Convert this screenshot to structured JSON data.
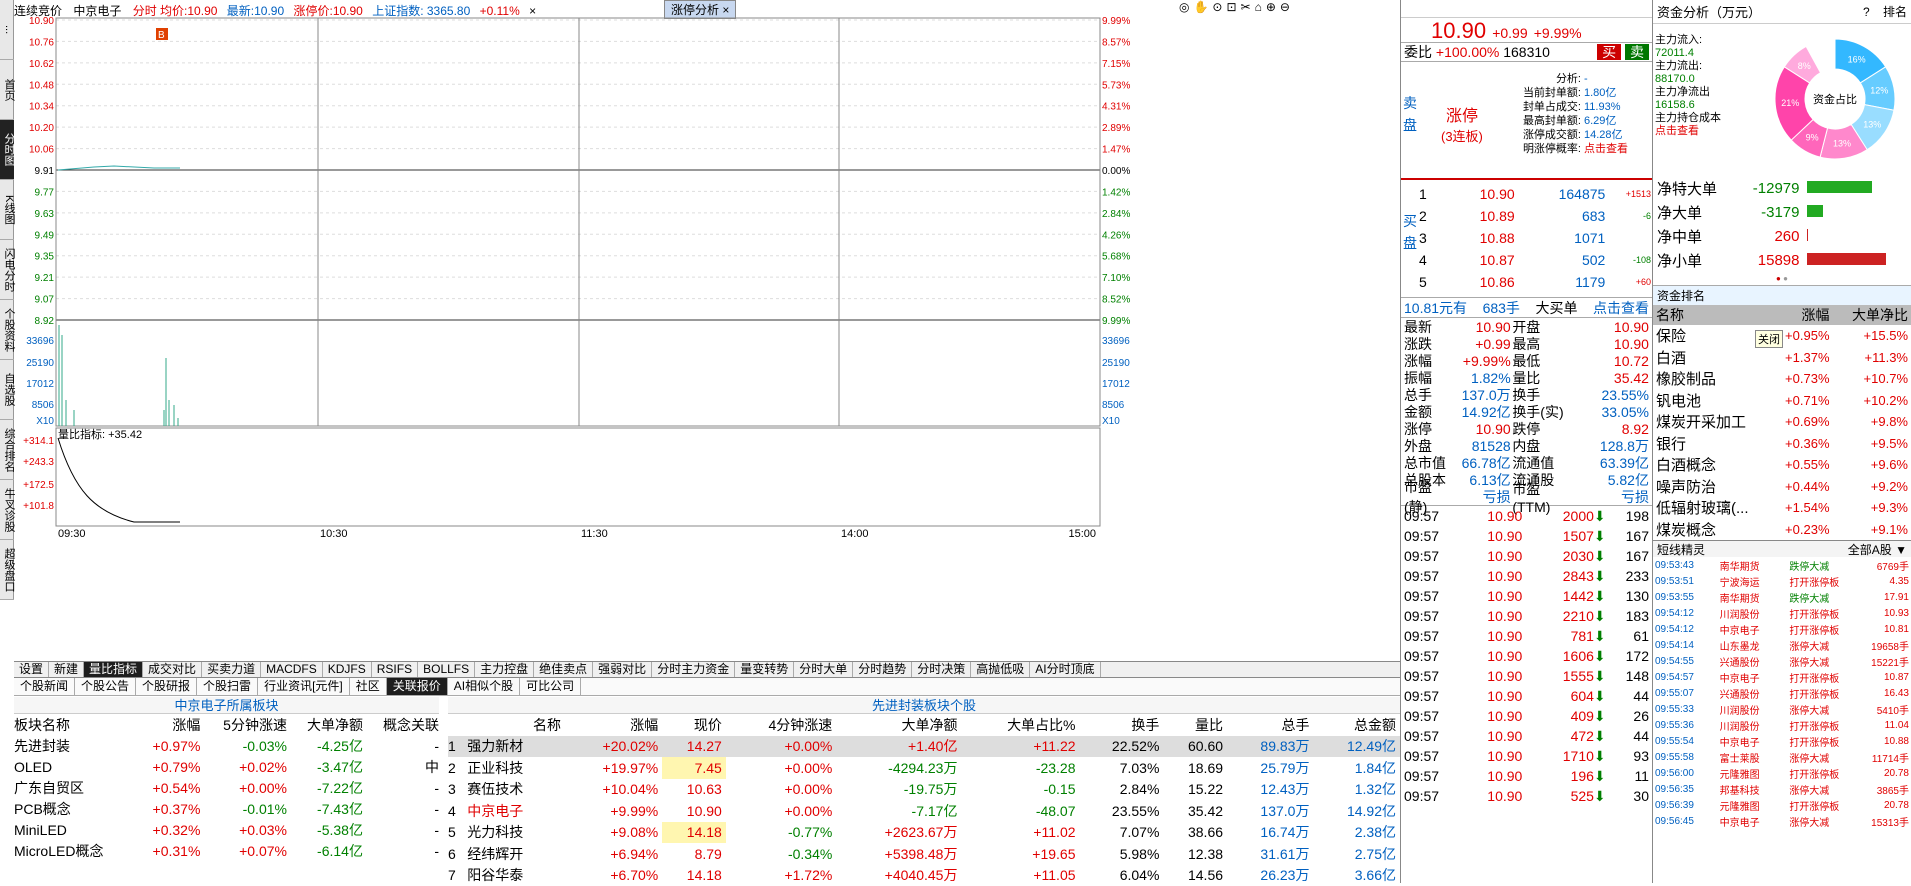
{
  "left_tabs": [
    "...",
    "首页",
    "分时图",
    "K线图",
    "闪电分时",
    "个股资料",
    "自选股",
    "综合排名",
    "牛叉诊股",
    "超级盘口"
  ],
  "chart": {
    "title_mode": "连续竞价",
    "stock": "中京电子",
    "legend": "分时 均价:10.90",
    "latest": "最新:10.90",
    "limit_up": "涨停价:10.90",
    "index": "上证指数: 3365.80",
    "index_pct": "+0.11%",
    "tab": "涨停分析",
    "price_labels": [
      "10.90",
      "10.76",
      "10.62",
      "10.48",
      "10.34",
      "10.20",
      "10.06",
      "9.91",
      "9.77",
      "9.63",
      "9.49",
      "9.35",
      "9.21",
      "9.07",
      "8.92"
    ],
    "pct_labels": [
      "9.99%",
      "8.57%",
      "7.15%",
      "5.73%",
      "4.31%",
      "2.89%",
      "1.47%",
      "0.00%",
      "1.42%",
      "2.84%",
      "4.26%",
      "5.68%",
      "7.10%",
      "8.52%",
      "9.99%"
    ],
    "vol_labels": [
      "33696",
      "25190",
      "17012",
      "8506",
      "X10"
    ],
    "ratio_title": "量比指标: +35.42",
    "ratio_labels": [
      "+314.1",
      "+243.3",
      "+172.5",
      "+101.8"
    ],
    "time_labels": [
      "09:30",
      "10:30",
      "11:30",
      "14:00",
      "15:00"
    ]
  },
  "toolbar": [
    "设置",
    "新建",
    "量比指标",
    "成交对比",
    "买卖力道",
    "MACDFS",
    "KDJFS",
    "RSIFS",
    "BOLLFS",
    "主力控盘",
    "绝佳卖点",
    "强弱对比",
    "分时主力资金",
    "量变转势",
    "分时大单",
    "分时趋势",
    "分时决策",
    "高抛低吸",
    "AI分时顶底"
  ],
  "subtabs": [
    "个股新闻",
    "个股公告",
    "个股研报",
    "个股扫雷",
    "行业资讯[元件]",
    "社区",
    "关联报价",
    "AI相似个股",
    "可比公司"
  ],
  "sectors": {
    "caption": "中京电子所属板块",
    "headers": [
      "板块名称",
      "涨幅",
      "5分钟涨速",
      "大单净额",
      "概念关联"
    ],
    "rows": [
      [
        "先进封装",
        "+0.97%",
        "-0.03%",
        "-4.25亿",
        "-"
      ],
      [
        "OLED",
        "+0.79%",
        "+0.02%",
        "-3.47亿",
        "中"
      ],
      [
        "广东自贸区",
        "+0.54%",
        "+0.00%",
        "-7.22亿",
        "-"
      ],
      [
        "PCB概念",
        "+0.37%",
        "-0.01%",
        "-7.43亿",
        "-"
      ],
      [
        "MiniLED",
        "+0.32%",
        "+0.03%",
        "-5.38亿",
        "-"
      ],
      [
        "MicroLED概念",
        "+0.31%",
        "+0.07%",
        "-6.14亿",
        "-"
      ]
    ]
  },
  "stocks": {
    "caption": "先进封装板块个股",
    "headers": [
      "",
      "名称",
      "涨幅",
      "现价",
      "4分钟涨速",
      "大单净额",
      "大单占比%",
      "换手",
      "量比",
      "总手",
      "总金额"
    ],
    "rows": [
      [
        "1",
        "强力新材",
        "+20.02%",
        "14.27",
        "+0.00%",
        "+1.40亿",
        "+11.22",
        "22.52%",
        "60.60",
        "89.83万",
        "12.49亿"
      ],
      [
        "2",
        "正业科技",
        "+19.97%",
        "7.45",
        "+0.00%",
        "-4294.23万",
        "-23.28",
        "7.03%",
        "18.69",
        "25.79万",
        "1.84亿"
      ],
      [
        "3",
        "赛伍技术",
        "+10.04%",
        "10.63",
        "+0.00%",
        "-19.75万",
        "-0.15",
        "2.84%",
        "15.22",
        "12.43万",
        "1.32亿"
      ],
      [
        "4",
        "中京电子",
        "+9.99%",
        "10.90",
        "+0.00%",
        "-7.17亿",
        "-48.07",
        "23.55%",
        "35.42",
        "137.0万",
        "14.92亿"
      ],
      [
        "5",
        "光力科技",
        "+9.08%",
        "14.18",
        "-0.77%",
        "+2623.67万",
        "+11.02",
        "7.07%",
        "38.66",
        "16.74万",
        "2.38亿"
      ],
      [
        "6",
        "经纬辉开",
        "+6.94%",
        "8.79",
        "-0.34%",
        "+5398.48万",
        "+19.65",
        "5.98%",
        "12.38",
        "31.61万",
        "2.75亿"
      ],
      [
        "7",
        "阳谷华泰",
        "+6.70%",
        "14.18",
        "+1.72%",
        "+4040.45万",
        "+11.05",
        "6.04%",
        "14.56",
        "26.23万",
        "3.66亿"
      ]
    ]
  },
  "quote": {
    "price": "10.90",
    "chg": "+0.99",
    "pct": "+9.99%",
    "weibi": "委比",
    "weibi_val": "+100.00%",
    "weicha": "168310",
    "buy": "买",
    "sell": "卖",
    "sell_label": "卖盘",
    "limit_text": "涨停",
    "limit_sub": "(3连板)",
    "analysis": [
      [
        "分析:",
        "-"
      ],
      [
        "当前封单额:",
        "1.80亿"
      ],
      [
        "封单占成交:",
        "11.93%"
      ],
      [
        "最高封单额:",
        "6.29亿"
      ],
      [
        "涨停成交额:",
        "14.28亿"
      ],
      [
        "明涨停概率:",
        "点击查看"
      ]
    ],
    "buy_label": "买盘",
    "bids": [
      [
        "1",
        "10.90",
        "164875",
        "+1513"
      ],
      [
        "2",
        "10.89",
        "683",
        "-6"
      ],
      [
        "3",
        "10.88",
        "1071",
        ""
      ],
      [
        "4",
        "10.87",
        "502",
        "-108"
      ],
      [
        "5",
        "10.86",
        "1179",
        "+60"
      ]
    ],
    "big": [
      "10.81元有",
      "683手",
      "大买单",
      "点击查看"
    ],
    "stats": [
      [
        "最新",
        "10.90",
        "开盘",
        "10.90"
      ],
      [
        "涨跌",
        "+0.99",
        "最高",
        "10.90"
      ],
      [
        "涨幅",
        "+9.99%",
        "最低",
        "10.72"
      ],
      [
        "振幅",
        "1.82%",
        "量比",
        "35.42"
      ],
      [
        "总手",
        "137.0万",
        "换手",
        "23.55%"
      ],
      [
        "金额",
        "14.92亿",
        "换手(实)",
        "33.05%"
      ],
      [
        "涨停",
        "10.90",
        "跌停",
        "8.92"
      ],
      [
        "外盘",
        "81528",
        "内盘",
        "128.8万"
      ],
      [
        "总市值",
        "66.78亿",
        "流通值",
        "63.39亿"
      ],
      [
        "总股本",
        "6.13亿",
        "流通股",
        "5.82亿"
      ],
      [
        "市盈(静)",
        "亏损",
        "市盈(TTM)",
        "亏损"
      ]
    ],
    "ticks": [
      [
        "09:57",
        "10.90",
        "2000",
        "198"
      ],
      [
        "09:57",
        "10.90",
        "1507",
        "167"
      ],
      [
        "09:57",
        "10.90",
        "2030",
        "167"
      ],
      [
        "09:57",
        "10.90",
        "2843",
        "233"
      ],
      [
        "09:57",
        "10.90",
        "1442",
        "130"
      ],
      [
        "09:57",
        "10.90",
        "2210",
        "183"
      ],
      [
        "09:57",
        "10.90",
        "781",
        "61"
      ],
      [
        "09:57",
        "10.90",
        "1606",
        "172"
      ],
      [
        "09:57",
        "10.90",
        "1555",
        "148"
      ],
      [
        "09:57",
        "10.90",
        "604",
        "44"
      ],
      [
        "09:57",
        "10.90",
        "409",
        "26"
      ],
      [
        "09:57",
        "10.90",
        "472",
        "44"
      ],
      [
        "09:57",
        "10.90",
        "1710",
        "93"
      ],
      [
        "09:57",
        "10.90",
        "196",
        "11"
      ],
      [
        "09:57",
        "10.90",
        "525",
        "30"
      ]
    ]
  },
  "fund": {
    "title": "资金分析（万元）",
    "help": "?",
    "rank": "排名",
    "items": [
      [
        "主力流入:",
        "72011.4"
      ],
      [
        "主力流出:",
        "88170.0"
      ],
      [
        "主力净流出",
        "16158.6"
      ],
      [
        "主力持仓成本",
        "点击查看"
      ]
    ],
    "donut_center": "资金占比",
    "donut_pcts": [
      "16%",
      "12%",
      "13%",
      "13%",
      "9%",
      "21%",
      "8%"
    ],
    "net": [
      [
        "净特大单",
        "-12979"
      ],
      [
        "净大单",
        "-3179"
      ],
      [
        "净中单",
        "260"
      ],
      [
        "净小单",
        "15898"
      ]
    ],
    "rank_title": "资金排名",
    "rank_headers": [
      "名称",
      "涨幅",
      "大单净比"
    ],
    "ranks": [
      [
        "保险",
        "+0.95%",
        "+15.5%"
      ],
      [
        "白酒",
        "+1.37%",
        "+11.3%"
      ],
      [
        "橡胶制品",
        "+0.73%",
        "+10.7%"
      ],
      [
        "钒电池",
        "+0.71%",
        "+10.2%"
      ],
      [
        "煤炭开采加工",
        "+0.69%",
        "+9.8%"
      ],
      [
        "银行",
        "+0.36%",
        "+9.5%"
      ],
      [
        "白酒概念",
        "+0.55%",
        "+9.6%"
      ],
      [
        "噪声防治",
        "+0.44%",
        "+9.2%"
      ],
      [
        "低辐射玻璃(...",
        "+1.54%",
        "+9.3%"
      ],
      [
        "煤炭概念",
        "+0.23%",
        "+9.1%"
      ]
    ],
    "tooltip": "关闭",
    "short_title": "短线精灵",
    "short_filter": "全部A股",
    "shorts": [
      [
        "09:53:43",
        "南华期货",
        "跌停大减",
        "6769手"
      ],
      [
        "09:53:51",
        "宁波海运",
        "打开涨停板",
        "4.35"
      ],
      [
        "09:53:55",
        "南华期货",
        "跌停大减",
        "17.91"
      ],
      [
        "09:54:12",
        "川润股份",
        "打开涨停板",
        "10.93"
      ],
      [
        "09:54:12",
        "中京电子",
        "打开涨停板",
        "10.81"
      ],
      [
        "09:54:14",
        "山东墨龙",
        "涨停大减",
        "19658手"
      ],
      [
        "09:54:55",
        "兴通股份",
        "涨停大减",
        "15221手"
      ],
      [
        "09:54:57",
        "中京电子",
        "打开涨停板",
        "10.87"
      ],
      [
        "09:55:07",
        "兴通股份",
        "打开涨停板",
        "16.43"
      ],
      [
        "09:55:33",
        "川润股份",
        "涨停大减",
        "5410手"
      ],
      [
        "09:55:36",
        "川润股份",
        "打开涨停板",
        "11.04"
      ],
      [
        "09:55:54",
        "中京电子",
        "打开涨停板",
        "10.88"
      ],
      [
        "09:55:58",
        "富士莱股",
        "涨停大减",
        "11714手"
      ],
      [
        "09:56:00",
        "元隆雅图",
        "打开涨停板",
        "20.78"
      ],
      [
        "09:56:35",
        "邦基科技",
        "涨停大减",
        "3865手"
      ],
      [
        "09:56:39",
        "元隆雅图",
        "打开涨停板",
        "20.78"
      ],
      [
        "09:56:45",
        "中京电子",
        "涨停大减",
        "15313手"
      ]
    ]
  },
  "colors": {
    "up": "#e00000",
    "down": "#008000",
    "blue": "#0060c0"
  }
}
